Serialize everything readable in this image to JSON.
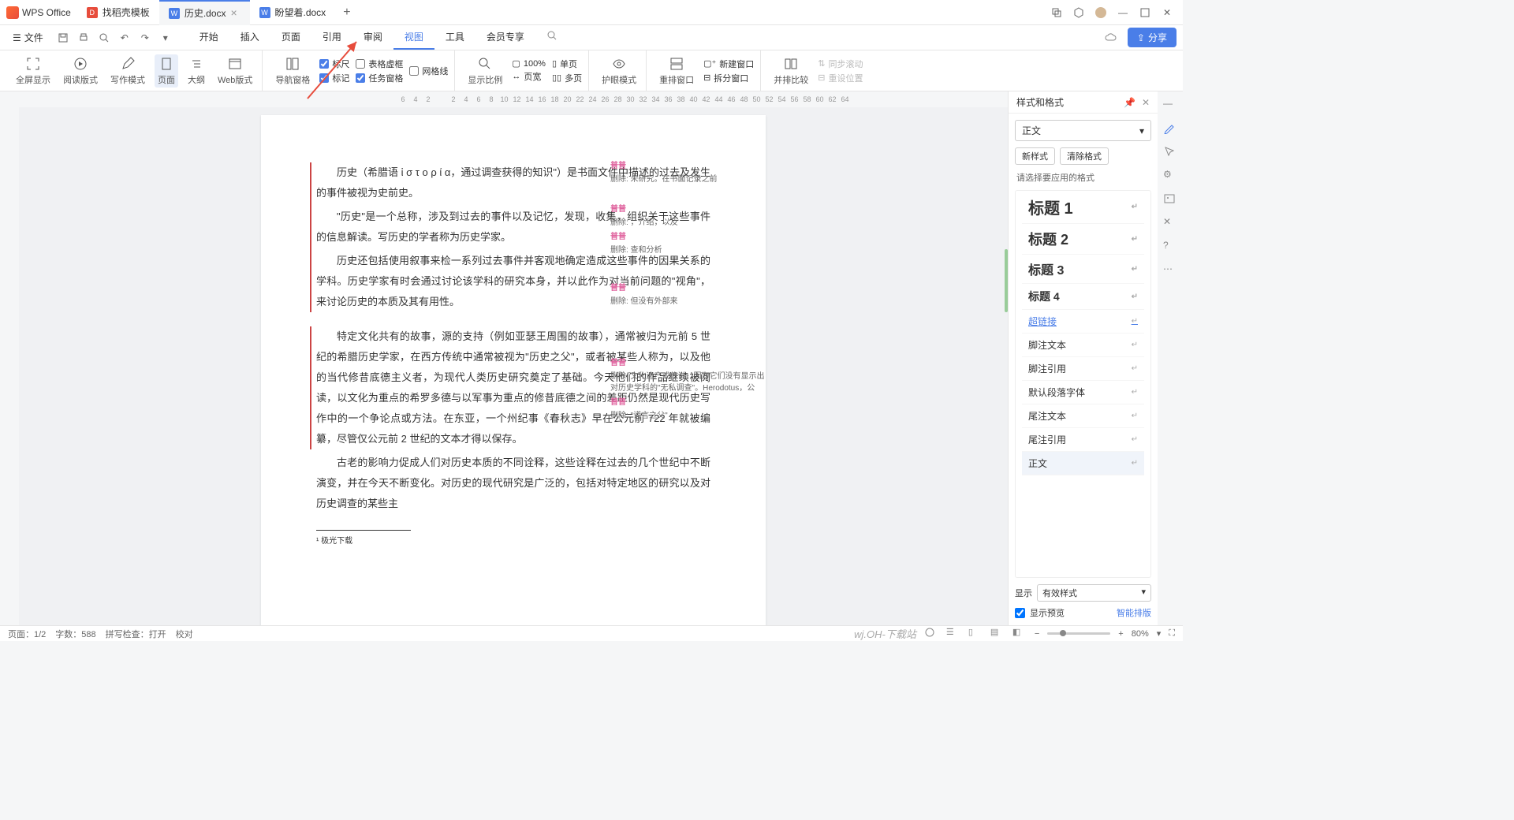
{
  "app": {
    "name": "WPS Office"
  },
  "tabs": [
    {
      "label": "找稻壳模板",
      "type": "tpl",
      "closable": false
    },
    {
      "label": "历史.docx",
      "type": "doc",
      "closable": true,
      "active": true
    },
    {
      "label": "盼望着.docx",
      "type": "doc",
      "closable": false
    }
  ],
  "menubar": {
    "file": "文件",
    "items": [
      "开始",
      "插入",
      "页面",
      "引用",
      "审阅",
      "视图",
      "工具",
      "会员专享"
    ],
    "active": "视图",
    "share": "分享"
  },
  "ribbon": {
    "fullscreen": "全屏显示",
    "readmode": "阅读版式",
    "writemode": "写作模式",
    "pageview": "页面",
    "outline": "大纲",
    "webview": "Web版式",
    "navpane": "导航窗格",
    "ruler": "标尺",
    "marks": "标记",
    "tablegrid": "表格虚框",
    "taskpane": "任务窗格",
    "gridlines": "网格线",
    "zoomratio": "显示比例",
    "pct100": "100%",
    "pagewidth": "页宽",
    "singlepage": "单页",
    "multipage": "多页",
    "eyecare": "护眼模式",
    "rearrange": "重排窗口",
    "splitwin": "拆分窗口",
    "newwin": "新建窗口",
    "sidebyside": "并排比较",
    "syncscroll": "同步滚动",
    "resetpos": "重设位置"
  },
  "ruler_nums": [
    "6",
    "4",
    "2",
    "",
    "2",
    "4",
    "6",
    "8",
    "10",
    "12",
    "14",
    "16",
    "18",
    "20",
    "22",
    "24",
    "26",
    "28",
    "30",
    "32",
    "34",
    "36",
    "38",
    "40",
    "42",
    "44",
    "46",
    "48",
    "50",
    "52",
    "54",
    "56",
    "58",
    "60",
    "62",
    "64"
  ],
  "doc": {
    "p1": "历史（希腊语 ἱ σ τ ο ρ ί α，通过调查获得的知识\"）是书面文件中描述的过去及发生的事件被视为史前史。",
    "p2": "\"历史\"是一个总称，涉及到过去的事件以及记忆，发现，收集，组织关于这些事件的信息解读。写历史的学者称为历史学家。",
    "p3": "历史还包括使用叙事来检一系列过去事件并客观地确定造成这些事件的因果关系的学科。历史学家有时会通过讨论该学科的研究本身，并以此作为对当前问题的\"视角\"，来讨论历史的本质及其有用性。",
    "p4": "特定文化共有的故事，源的支持（例如亚瑟王周围的故事），通常被归为元前 5 世纪的希腊历史学家，在西方传统中通常被视为\"历史之父\"，或者被某些人称为，以及他的当代修昔底德主义者，为现代人类历史研究奠定了基础。今天他们的作品继续被阅读，以文化为重点的希罗多德与以军事为重点的修昔底德之间的差距仍然是现代历史写作中的一个争论点或方法。在东亚，一个州纪事《春秋志》早在公元前 722 年就被编纂，尽管仅公元前 2 世纪的文本才得以保存。",
    "p5": "古老的影响力促成人们对历史本质的不同诠释，这些诠释在过去的几个世纪中不断演变，并在今天不断变化。对历史的现代研究是广泛的，包括对特定地区的研究以及对历史调查的某些主",
    "footnote": "¹ 极光下载"
  },
  "revisions": [
    {
      "author": "普普",
      "text": "删除: 未研究。在书面记录之前"
    },
    {
      "author": "普普",
      "text": "删除: ，介绍，以及"
    },
    {
      "author": "普普",
      "text": "删除: 查和分析"
    },
    {
      "author": "普普",
      "text": "删除: 但没有外部来"
    },
    {
      "author": "普普",
      "text": "删除: 文化遗产或传说，因为它们没有显示出对历史学科的\"无私调查\"。Herodotus，公"
    },
    {
      "author": "普普",
      "text": "删除: \"谎言之父\""
    }
  ],
  "styles_panel": {
    "title": "样式和格式",
    "current": "正文",
    "new_style": "新样式",
    "clear_format": "清除格式",
    "hint": "请选择要应用的格式",
    "items": [
      {
        "name": "标题 1",
        "cls": "h1"
      },
      {
        "name": "标题 2",
        "cls": "h2"
      },
      {
        "name": "标题 3",
        "cls": "h3"
      },
      {
        "name": "标题 4",
        "cls": "h4"
      },
      {
        "name": "超链接",
        "cls": "link"
      },
      {
        "name": "脚注文本",
        "cls": ""
      },
      {
        "name": "脚注引用",
        "cls": ""
      },
      {
        "name": "默认段落字体",
        "cls": ""
      },
      {
        "name": "尾注文本",
        "cls": ""
      },
      {
        "name": "尾注引用",
        "cls": ""
      },
      {
        "name": "正文",
        "cls": "selected"
      }
    ],
    "show_label": "显示",
    "show_value": "有效样式",
    "preview": "显示预览",
    "smart_layout": "智能排版"
  },
  "statusbar": {
    "page": "页面：1/2",
    "words": "字数：588",
    "spell": "拼写检查：打开",
    "proof": "校对",
    "zoom": "80%"
  },
  "watermark": "wj.OH-下载站"
}
